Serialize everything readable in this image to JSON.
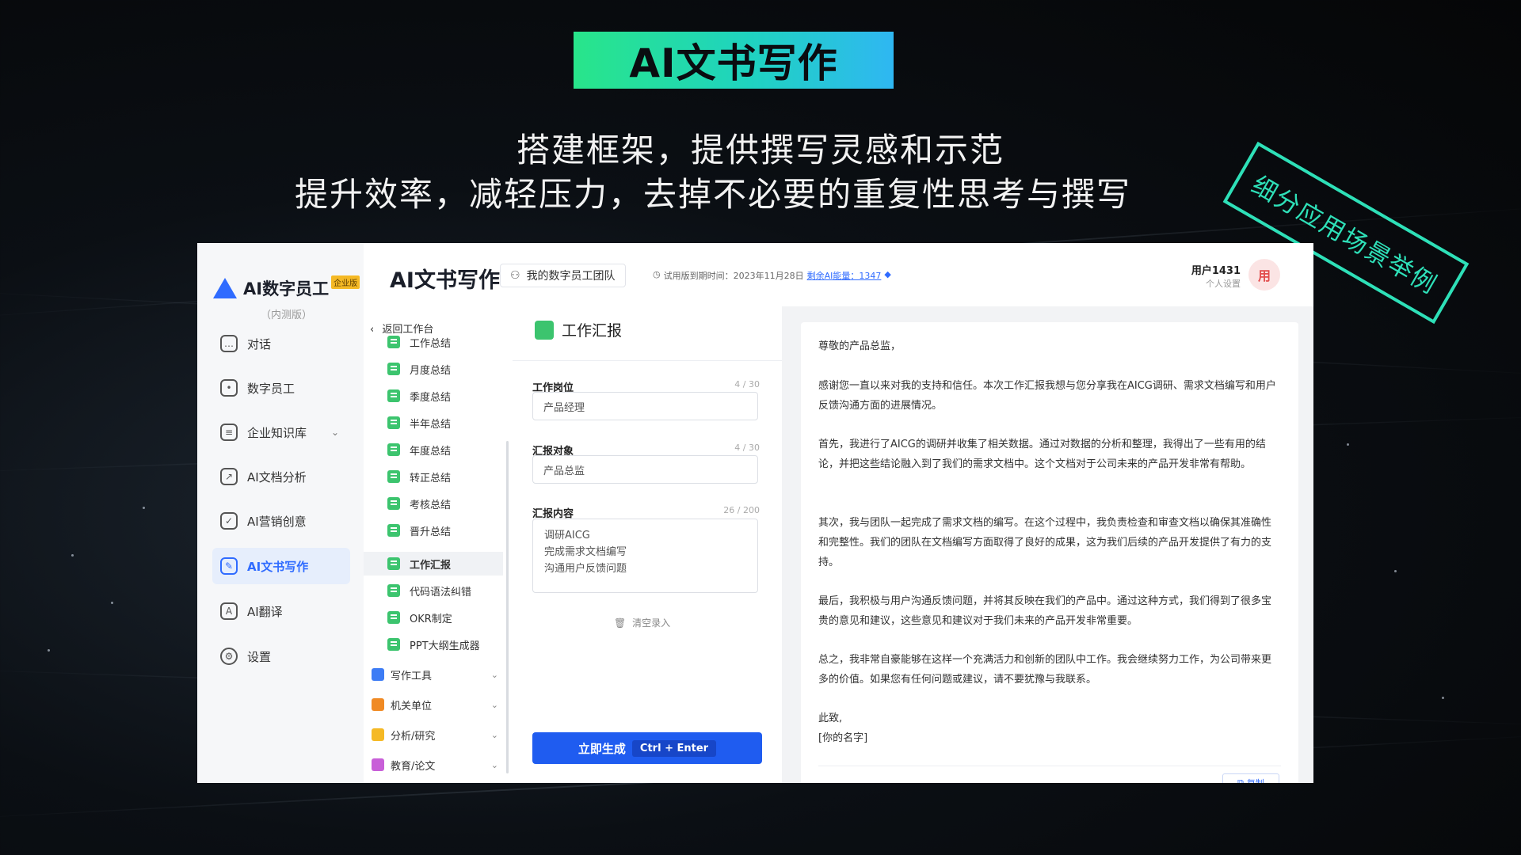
{
  "slide": {
    "title": "AI文书写作",
    "subtitle_line1": "搭建框架，提供撰写灵感和示范",
    "subtitle_line2": "提升效率，减轻压力，去掉不必要的重复性思考与撰写",
    "stamp": "细分应用场景举例"
  },
  "colors": {
    "accent": "#2f6bff",
    "badge_start": "#28e58a",
    "badge_end": "#2fb7f2",
    "stamp": "#2ee0b8",
    "doc_green": "#3cc46e"
  },
  "app": {
    "logo": {
      "name": "AI数字员工",
      "tag": "企业版",
      "sub": "（内测版）"
    },
    "nav": [
      {
        "label": "对话",
        "icon": "chat-icon"
      },
      {
        "label": "数字员工",
        "icon": "robot-icon"
      },
      {
        "label": "企业知识库",
        "icon": "book-icon"
      },
      {
        "label": "AI文档分析",
        "icon": "analysis-icon"
      },
      {
        "label": "AI营销创意",
        "icon": "bulb-icon"
      },
      {
        "label": "AI文书写作",
        "icon": "edit-icon",
        "active": true
      },
      {
        "label": "AI翻译",
        "icon": "translate-icon"
      },
      {
        "label": "设置",
        "icon": "gear-icon"
      }
    ],
    "header": {
      "title": "AI文书写作",
      "team_button": "我的数字员工团队",
      "trial_label": "试用版到期时间：2023年11月28日",
      "energy_label": "剩余AI能量：1347",
      "user_name": "用户1431",
      "user_sub": "个人设置",
      "avatar": "用"
    },
    "tree": {
      "back": "返回工作台",
      "items": [
        "工作总结",
        "月度总结",
        "季度总结",
        "半年总结",
        "年度总结",
        "转正总结",
        "考核总结",
        "晋升总结",
        "工作汇报",
        "代码语法纠错",
        "OKR制定",
        "PPT大纲生成器"
      ],
      "selected": "工作汇报",
      "categories": [
        {
          "label": "写作工具",
          "color": "#3d7cf5"
        },
        {
          "label": "机关单位",
          "color": "#f08a24"
        },
        {
          "label": "分析/研究",
          "color": "#f5b925"
        },
        {
          "label": "教育/论文",
          "color": "#c85fd8"
        }
      ]
    },
    "form": {
      "title": "工作汇报",
      "position_label": "工作岗位",
      "position_count": "4 / 30",
      "position_value": "产品经理",
      "target_label": "汇报对象",
      "target_count": "4 / 30",
      "target_value": "产品总监",
      "content_label": "汇报内容",
      "content_count": "26 / 200",
      "content_lines": [
        "调研AICG",
        "完成需求文档编写",
        "沟通用户反馈问题"
      ],
      "clear": "清空录入",
      "generate": "立即生成",
      "shortcut": "Ctrl + Enter"
    },
    "output": {
      "paragraphs": [
        "尊敬的产品总监，",
        "感谢您一直以来对我的支持和信任。本次工作汇报我想与您分享我在AICG调研、需求文档编写和用户反馈沟通方面的进展情况。",
        "首先，我进行了AICG的调研并收集了相关数据。通过对数据的分析和整理，我得出了一些有用的结论，并把这些结论融入到了我们的需求文档中。这个文档对于公司未来的产品开发非常有帮助。",
        "其次，我与团队一起完成了需求文档的编写。在这个过程中，我负责检查和审查文档以确保其准确性和完整性。我们的团队在文档编写方面取得了良好的成果，这为我们后续的产品开发提供了有力的支持。",
        "最后，我积极与用户沟通反馈问题，并将其反映在我们的产品中。通过这种方式，我们得到了很多宝贵的意见和建议，这些意见和建议对于我们未来的产品开发非常重要。",
        "总之，我非常自豪能够在这样一个充满活力和创新的团队中工作。我会继续努力工作，为公司带来更多的价值。如果您有任何问题或建议，请不要犹豫与我联系。",
        "此致,",
        "[你的名字]"
      ],
      "copy": "复制"
    }
  }
}
